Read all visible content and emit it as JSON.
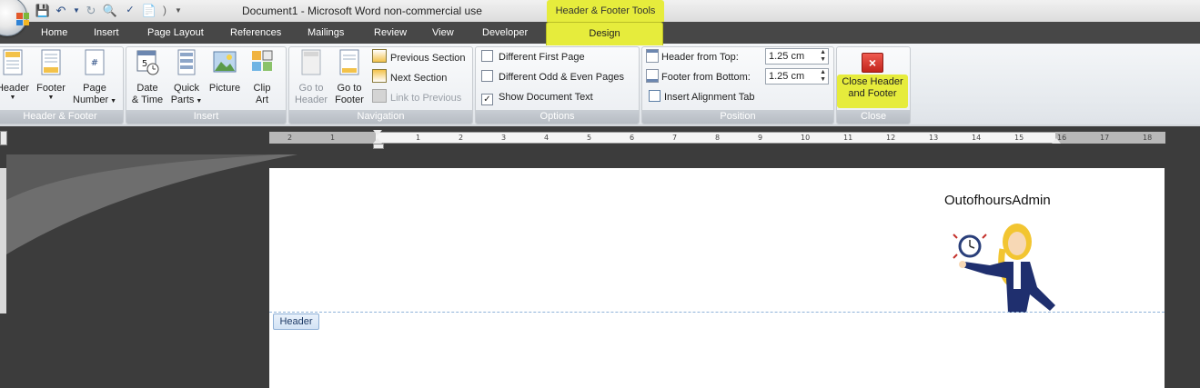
{
  "window": {
    "title": "Document1 - Microsoft Word non-commercial use",
    "contextual_tools": "Header & Footer Tools"
  },
  "tabs": [
    "Home",
    "Insert",
    "Page Layout",
    "References",
    "Mailings",
    "Review",
    "View",
    "Developer"
  ],
  "active_tab": "Design",
  "groups": {
    "header_footer": {
      "label": "Header & Footer",
      "header": "Header",
      "footer": "Footer",
      "page_number_l1": "Page",
      "page_number_l2": "Number"
    },
    "insert": {
      "label": "Insert",
      "date_l1": "Date",
      "date_l2": "& Time",
      "quick_l1": "Quick",
      "quick_l2": "Parts",
      "picture": "Picture",
      "clip_l1": "Clip",
      "clip_l2": "Art"
    },
    "navigation": {
      "label": "Navigation",
      "goto_header_l1": "Go to",
      "goto_header_l2": "Header",
      "goto_footer_l1": "Go to",
      "goto_footer_l2": "Footer",
      "previous_section": "Previous Section",
      "next_section": "Next Section",
      "link_to_previous": "Link to Previous"
    },
    "options": {
      "label": "Options",
      "different_first_page": "Different First Page",
      "different_odd_even": "Different Odd & Even Pages",
      "show_document_text": "Show Document Text",
      "checks": [
        false,
        false,
        true
      ]
    },
    "position": {
      "label": "Position",
      "header_from_top": "Header from Top:",
      "header_from_top_value": "1.25 cm",
      "footer_from_bottom": "Footer from Bottom:",
      "footer_from_bottom_value": "1.25 cm",
      "insert_alignment_tab": "Insert Alignment Tab"
    },
    "close": {
      "label": "Close",
      "close_l1": "Close Header",
      "close_l2": "and Footer"
    }
  },
  "ruler": {
    "ticks": [
      "2",
      "1",
      "1",
      "2",
      "3",
      "4",
      "5",
      "6",
      "7",
      "8",
      "9",
      "10",
      "11",
      "12",
      "13",
      "14",
      "15",
      "16",
      "17",
      "18"
    ]
  },
  "document": {
    "header_text": "OutofhoursAdmin",
    "header_tag": "Header"
  },
  "colors": {
    "highlight": "#e6ec3c",
    "close_red": "#d9322b",
    "ribbon_bg": "#e6eaee",
    "tab_bar": "#474747"
  }
}
